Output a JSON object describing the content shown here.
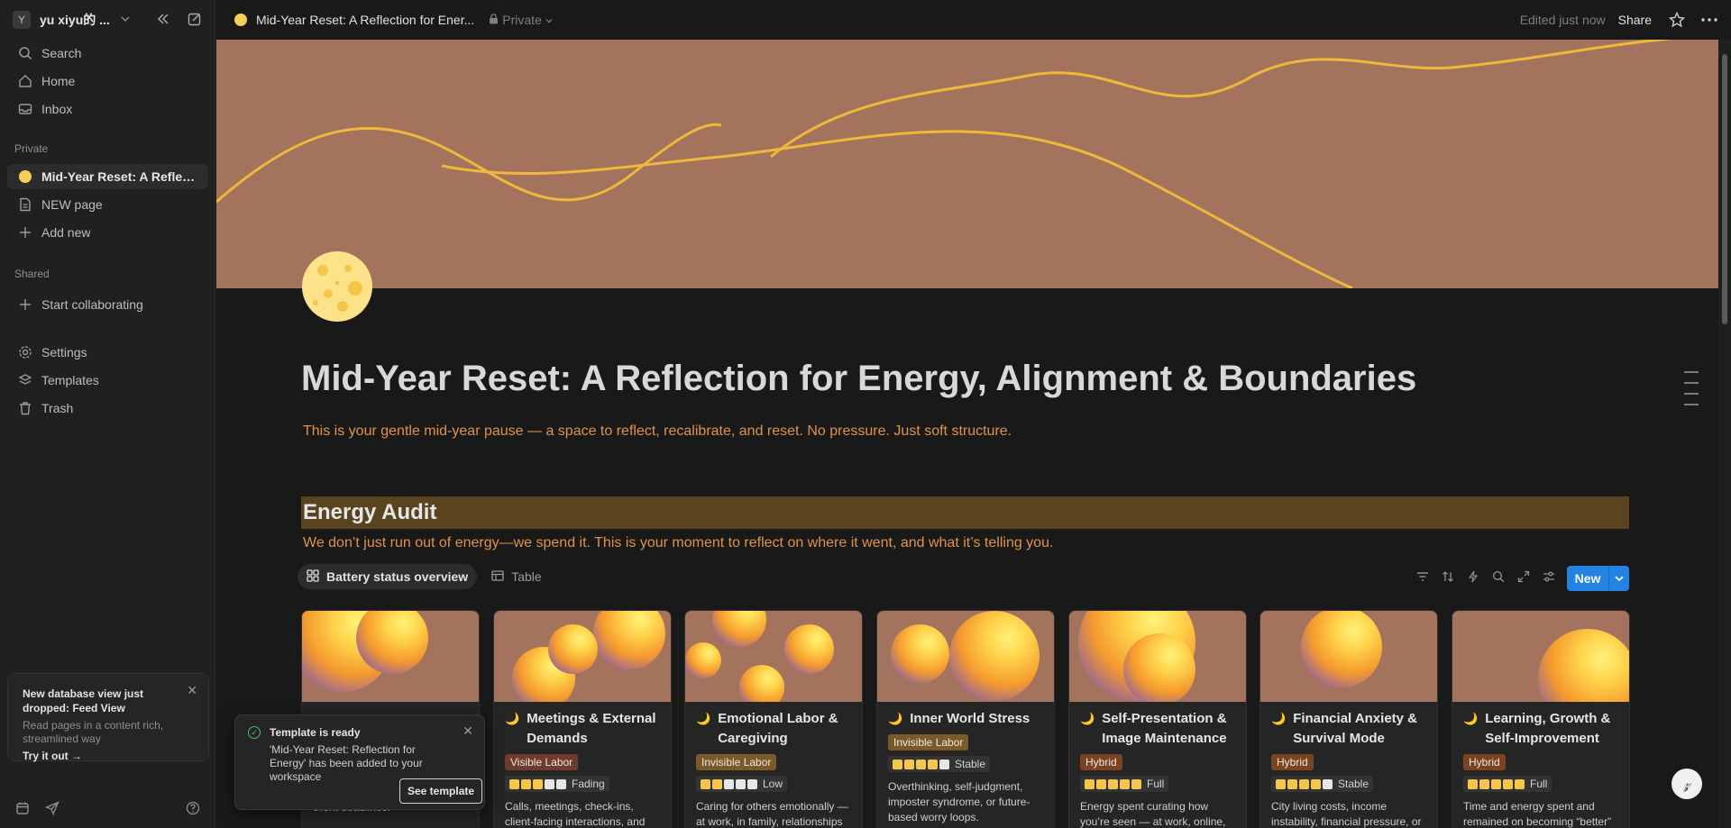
{
  "sidebar": {
    "workspace_initial": "Y",
    "workspace_name": "yu xiyu的 ...",
    "nav": [
      {
        "label": "Search",
        "icon": "search-icon"
      },
      {
        "label": "Home",
        "icon": "home-icon"
      },
      {
        "label": "Inbox",
        "icon": "inbox-icon"
      }
    ],
    "private_label": "Private",
    "private_pages": [
      {
        "label": "Mid-Year Reset: A Reflection for Energy",
        "icon": "sun-icon",
        "active": true
      },
      {
        "label": "NEW page",
        "icon": "page-icon"
      },
      {
        "label": "Add new",
        "icon": "plus-icon"
      }
    ],
    "shared_label": "Shared",
    "shared_items": [
      {
        "label": "Start collaborating",
        "icon": "plus-icon"
      }
    ],
    "bottom_items": [
      {
        "label": "Settings",
        "icon": "gear-icon"
      },
      {
        "label": "Templates",
        "icon": "templates-icon"
      },
      {
        "label": "Trash",
        "icon": "trash-icon"
      }
    ],
    "promo": {
      "title": "New database view just dropped: Feed View",
      "body": "Read pages in a content rich, streamlined way",
      "link": "Try it out"
    }
  },
  "topbar": {
    "title": "Mid-Year Reset: A Reflection for Ener...",
    "privacy": "Private",
    "edited": "Edited just now",
    "share": "Share"
  },
  "page": {
    "title": "Mid-Year Reset: A Reflection for Energy, Alignment & Boundaries",
    "subtitle": "This is your gentle mid-year pause — a space to reflect, recalibrate, and reset. No pressure. Just soft structure.",
    "section_heading": "Energy Audit",
    "section_sub": "We don’t just run out of energy—we spend it. This is your moment to reflect on where it went, and what it’s telling you."
  },
  "database": {
    "views": [
      {
        "label": "Battery status overview",
        "icon": "gallery-icon",
        "active": true
      },
      {
        "label": "Table",
        "icon": "table-icon",
        "active": false
      }
    ],
    "new_label": "New",
    "cards": [
      {
        "title": "",
        "tag": "",
        "tag_type": "",
        "battery_filled": 0,
        "battery_label": "",
        "desc": "performance targets, internal or client deadlines."
      },
      {
        "title": "Meetings & External Demands",
        "tag": "Visible Labor",
        "tag_type": "visible",
        "battery_filled": 3,
        "battery_label": "Fading",
        "desc": "Calls, meetings, check-ins, client-facing interactions, and"
      },
      {
        "title": "Emotional Labor & Caregiving",
        "tag": "Invisible Labor",
        "tag_type": "invisible",
        "battery_filled": 2,
        "battery_label": "Low",
        "desc": "Caring for others emotionally — at work, in family, relationships"
      },
      {
        "title": "Inner World Stress",
        "tag": "Invisible Labor",
        "tag_type": "invisible",
        "battery_filled": 4,
        "battery_label": "Stable",
        "desc": "Overthinking, self-judgment, imposter syndrome, or future-based worry loops."
      },
      {
        "title": "Self-Presentation & Image Maintenance",
        "tag": "Hybrid",
        "tag_type": "hybrid",
        "battery_filled": 5,
        "battery_label": "Full",
        "desc": "Energy spent curating how you’re seen — at work, online, in"
      },
      {
        "title": "Financial Anxiety & Survival Mode",
        "tag": "Hybrid",
        "tag_type": "hybrid",
        "battery_filled": 4,
        "battery_label": "Stable",
        "desc": "City living costs, income instability, financial pressure, or"
      },
      {
        "title": "Learning, Growth & Self-Improvement",
        "tag": "Hybrid",
        "tag_type": "hybrid",
        "battery_filled": 5,
        "battery_label": "Full",
        "desc": "Time and energy spent and remained on becoming “better”"
      }
    ]
  },
  "toast": {
    "title": "Template is ready",
    "body": "'Mid-Year Reset: Reflection for Energy' has been added to your workspace",
    "button": "See template"
  },
  "colors": {
    "cover": "#a4735e",
    "accent_orange": "#e0924a",
    "heading_bg": "#59441f",
    "new_button": "#2383e2"
  }
}
